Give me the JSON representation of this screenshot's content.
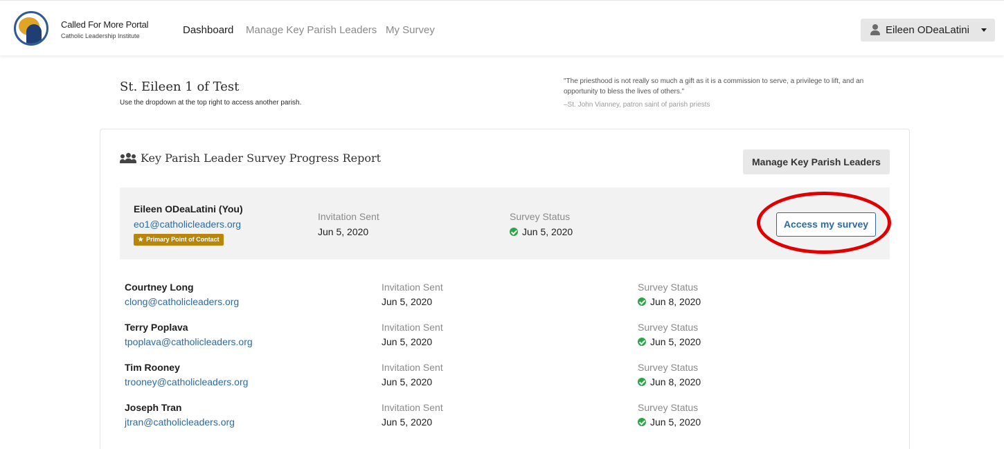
{
  "header": {
    "brand_title": "Called For More Portal",
    "brand_subtitle": "Catholic Leadership Institute",
    "nav": [
      {
        "label": "Dashboard",
        "active": true
      },
      {
        "label": "Manage Key Parish Leaders",
        "active": false
      },
      {
        "label": "My Survey",
        "active": false
      }
    ],
    "user_name": "Eileen ODeaLatini"
  },
  "parish": {
    "name": "St. Eileen 1 of Test",
    "subtitle": "Use the dropdown at the top right to access another parish."
  },
  "quote": {
    "text": "\"The priesthood is not really so much a gift as it is a commission to serve, a privilege to lift, and an opportunity to bless the lives of others.\"",
    "attribution": "–St. John Vianney, patron saint of parish priests"
  },
  "report": {
    "title": "Key Parish Leader Survey Progress Report",
    "manage_button": "Manage Key Parish Leaders",
    "you": {
      "name": "Eileen ODeaLatini (You)",
      "email": "eo1@catholicleaders.org",
      "badge": "Primary Point of Contact",
      "invitation_label": "Invitation Sent",
      "invitation_date": "Jun 5, 2020",
      "status_label": "Survey Status",
      "status_date": "Jun 5, 2020",
      "action_button": "Access my survey"
    },
    "leaders": [
      {
        "name": "Courtney Long",
        "email": "clong@catholicleaders.org",
        "invitation_label": "Invitation Sent",
        "invitation_date": "Jun 5, 2020",
        "status_label": "Survey Status",
        "status_date": "Jun 8, 2020"
      },
      {
        "name": "Terry Poplava",
        "email": "tpoplava@catholicleaders.org",
        "invitation_label": "Invitation Sent",
        "invitation_date": "Jun 5, 2020",
        "status_label": "Survey Status",
        "status_date": "Jun 5, 2020"
      },
      {
        "name": "Tim Rooney",
        "email": "trooney@catholicleaders.org",
        "invitation_label": "Invitation Sent",
        "invitation_date": "Jun 5, 2020",
        "status_label": "Survey Status",
        "status_date": "Jun 8, 2020"
      },
      {
        "name": "Joseph Tran",
        "email": "jtran@catholicleaders.org",
        "invitation_label": "Invitation Sent",
        "invitation_date": "Jun 5, 2020",
        "status_label": "Survey Status",
        "status_date": "Jun 5, 2020"
      }
    ]
  },
  "colors": {
    "link": "#2c6aa3",
    "badge": "#b8860b",
    "status_ok": "#28a745",
    "highlight": "#e00000"
  }
}
